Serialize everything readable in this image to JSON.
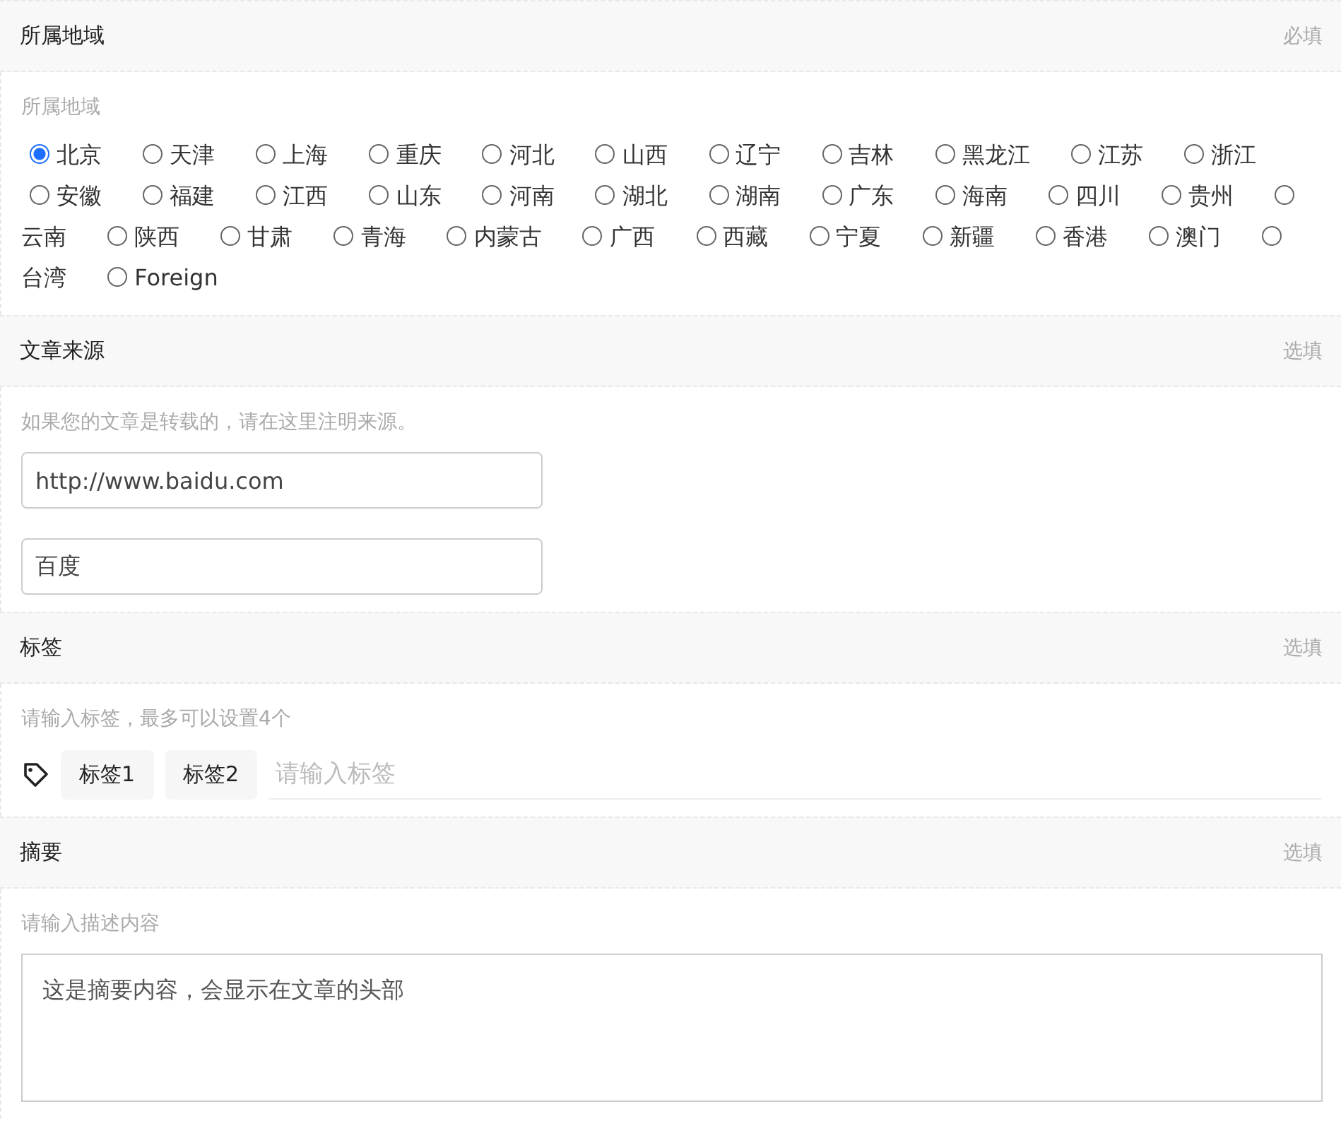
{
  "sections": [
    {
      "kind": "radios",
      "title": "所属地域",
      "requirement": "必填",
      "hint": "所属地域",
      "options": [
        {
          "label": "北京",
          "selected": true
        },
        {
          "label": "天津",
          "selected": false
        },
        {
          "label": "上海",
          "selected": false
        },
        {
          "label": "重庆",
          "selected": false
        },
        {
          "label": "河北",
          "selected": false
        },
        {
          "label": "山西",
          "selected": false
        },
        {
          "label": "辽宁",
          "selected": false
        },
        {
          "label": "吉林",
          "selected": false
        },
        {
          "label": "黑龙江",
          "selected": false
        },
        {
          "label": "江苏",
          "selected": false
        },
        {
          "label": "浙江",
          "selected": false
        },
        {
          "label": "安徽",
          "selected": false
        },
        {
          "label": "福建",
          "selected": false
        },
        {
          "label": "江西",
          "selected": false
        },
        {
          "label": "山东",
          "selected": false
        },
        {
          "label": "河南",
          "selected": false
        },
        {
          "label": "湖北",
          "selected": false
        },
        {
          "label": "湖南",
          "selected": false
        },
        {
          "label": "广东",
          "selected": false
        },
        {
          "label": "海南",
          "selected": false
        },
        {
          "label": "四川",
          "selected": false
        },
        {
          "label": "贵州",
          "selected": false
        },
        {
          "label": "云南",
          "selected": false
        },
        {
          "label": "陕西",
          "selected": false
        },
        {
          "label": "甘肃",
          "selected": false
        },
        {
          "label": "青海",
          "selected": false
        },
        {
          "label": "内蒙古",
          "selected": false
        },
        {
          "label": "广西",
          "selected": false
        },
        {
          "label": "西藏",
          "selected": false
        },
        {
          "label": "宁夏",
          "selected": false
        },
        {
          "label": "新疆",
          "selected": false
        },
        {
          "label": "香港",
          "selected": false
        },
        {
          "label": "澳门",
          "selected": false
        },
        {
          "label": "台湾",
          "selected": false
        },
        {
          "label": "Foreign",
          "selected": false
        }
      ]
    },
    {
      "kind": "inputs",
      "title": "文章来源",
      "requirement": "选填",
      "hint": "如果您的文章是转载的，请在这里注明来源。",
      "fields": [
        {
          "value": "http://www.baidu.com"
        },
        {
          "value": "百度"
        }
      ]
    },
    {
      "kind": "tags",
      "title": "标签",
      "requirement": "选填",
      "hint": "请输入标签，最多可以设置4个",
      "tags": [
        "标签1",
        "标签2"
      ],
      "placeholder": "请输入标签"
    },
    {
      "kind": "textarea",
      "title": "摘要",
      "requirement": "选填",
      "hint": "请输入描述内容",
      "value": "这是摘要内容，会显示在文章的头部"
    }
  ]
}
